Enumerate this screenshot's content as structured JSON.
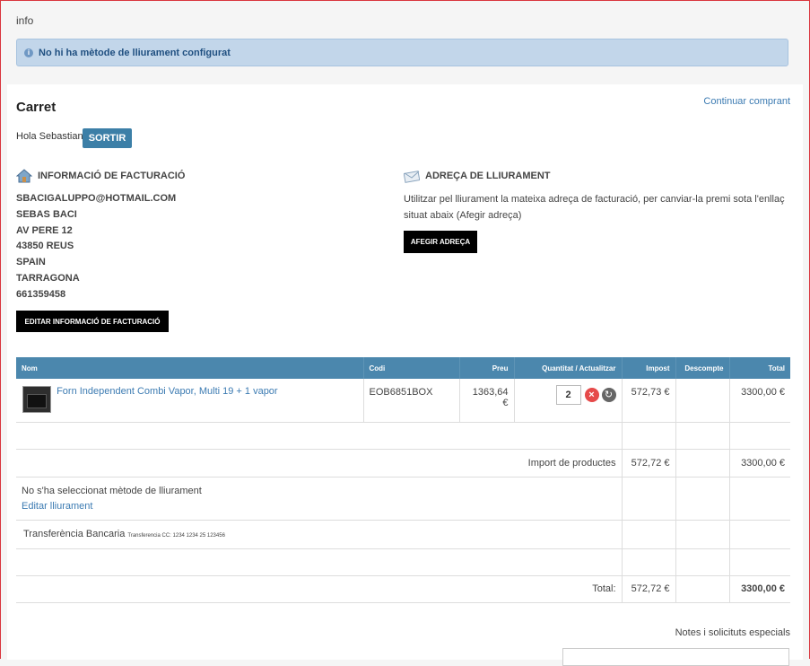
{
  "info": {
    "title": "info"
  },
  "alert": {
    "message": "No hi ha mètode de lliurament configurat",
    "icon": "info-icon"
  },
  "cart": {
    "title": "Carret",
    "continue_label": "Continuar comprant",
    "greeting": "Hola Sebastian",
    "logout_label": "SORTIR"
  },
  "billing": {
    "heading": "INFORMACIÓ DE FACTURACIÓ",
    "icon": "house-icon",
    "lines": [
      "SBACIGALUPPO@HOTMAIL.COM",
      "SEBAS BACI",
      "AV PERE 12",
      "43850 REUS",
      "SPAIN",
      "TARRAGONA",
      "661359458"
    ],
    "edit_label": "EDITAR INFORMACIÓ DE FACTURACIÓ"
  },
  "shipping": {
    "heading": "ADREÇA DE LLIURAMENT",
    "icon": "envelope-icon",
    "text": "Utilitzar pel lliurament la mateixa adreça de facturació, per canviar-la premi sota l'enllaç situat abaix (Afegir adreça)",
    "add_label": "AFEGIR ADREÇA"
  },
  "table": {
    "headers": [
      "Nom",
      "Codi",
      "Preu",
      "Quantitat / Actualitzar",
      "Impost",
      "Descompte",
      "Total"
    ],
    "item": {
      "name": "Forn Independent Combi Vapor, Multi 19 + 1 vapor",
      "code": "EOB6851BOX",
      "price": "1363,64 €",
      "qty": "2",
      "tax": "572,73 €",
      "discount": "",
      "total": "3300,00 €"
    },
    "subtotal": {
      "label": "Import de productes",
      "tax": "572,72 €",
      "total": "3300,00 €"
    },
    "shipping": {
      "label": "No s'ha seleccionat mètode de lliurament",
      "edit_label": "Editar lliurament"
    },
    "payment": {
      "label": "Transferència Bancaria",
      "note": "Transferencia CC: 1234 1234 25 123456"
    },
    "grand_total": {
      "label": "Total:",
      "tax": "572,72 €",
      "total": "3300,00 €"
    }
  },
  "notes": {
    "label": "Notes i solicituts especials"
  },
  "colors": {
    "accent": "#4b87ad",
    "link": "#3c7bb2",
    "alert_bg": "#c2d6ea",
    "frame": "#d9363e"
  }
}
